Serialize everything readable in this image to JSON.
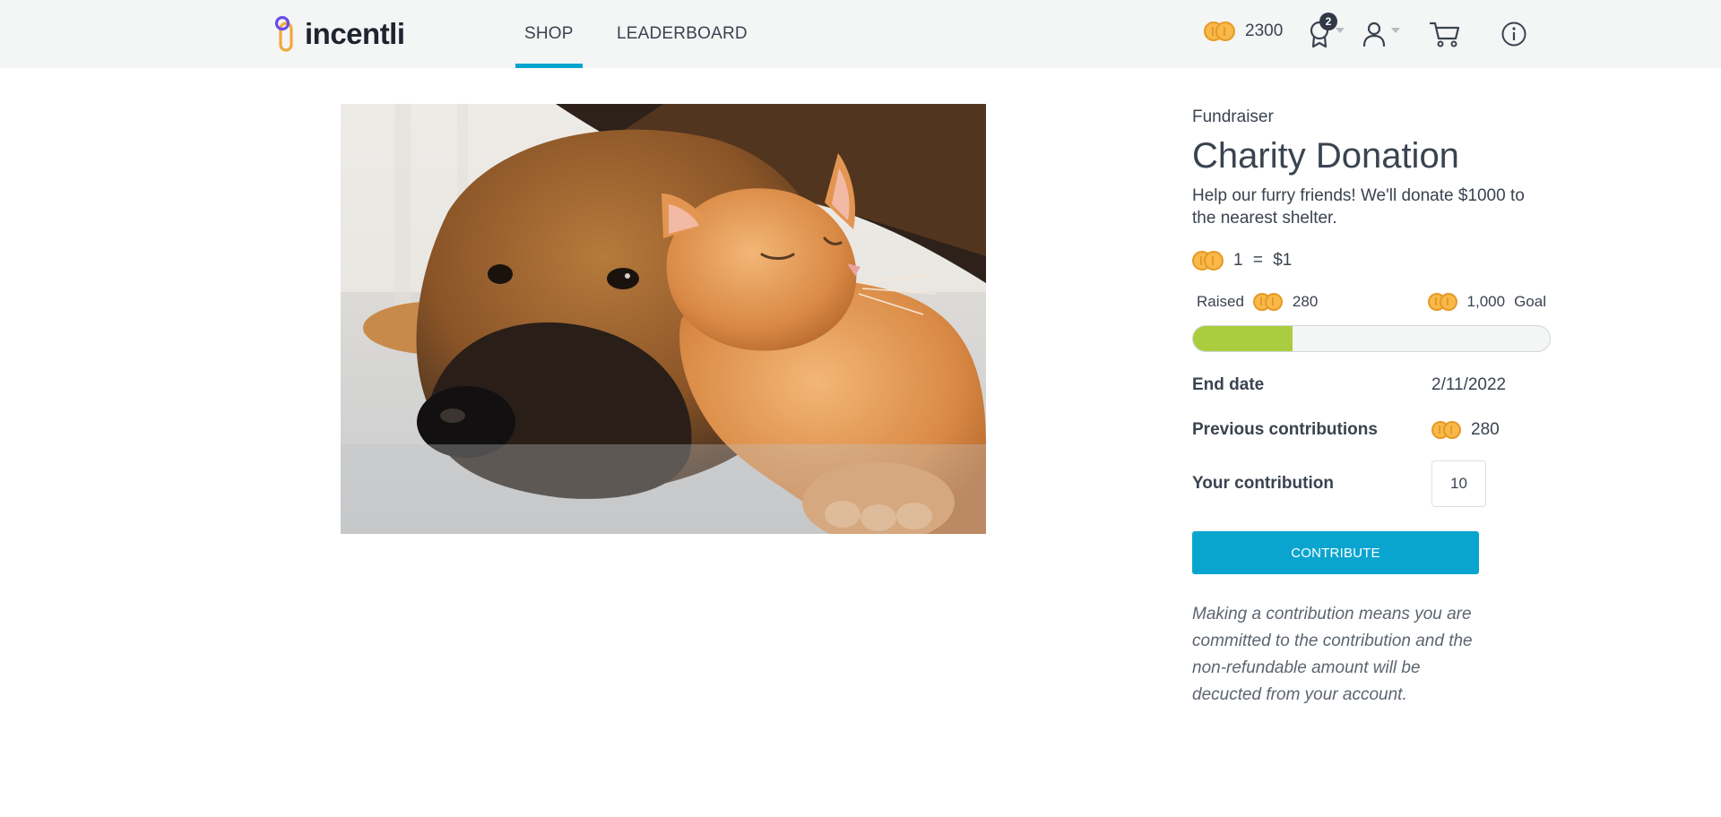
{
  "app": {
    "logo_text": "incentli"
  },
  "nav": {
    "tabs": [
      {
        "label": "SHOP",
        "active": true
      },
      {
        "label": "LEADERBOARD",
        "active": false
      }
    ]
  },
  "header": {
    "coin_balance": "2300",
    "awards_badge": "2",
    "icons": [
      "coins-icon",
      "award-icon",
      "user-icon",
      "cart-icon",
      "info-icon"
    ]
  },
  "product": {
    "category": "Fundraiser",
    "title": "Charity Donation",
    "description": "Help our furry friends! We'll donate $1000 to the nearest shelter.",
    "rate_text": "1 = $1",
    "raised_label": "Raised",
    "raised_value": "280",
    "goal_value": "1,000",
    "goal_label": "Goal",
    "progress_fraction": 0.28,
    "end_date_label": "End date",
    "end_date_value": "2/11/2022",
    "prev_contrib_label": "Previous contributions",
    "prev_contrib_value": "280",
    "your_contrib_label": "Your contribution",
    "your_contrib_value": "10",
    "button_label": "CONTRIBUTE",
    "disclaimer": "Making a contribution means you are committed to the contribution and the non-refundable amount will be decucted from your account."
  },
  "colors": {
    "accent": "#0aa5cf",
    "progress": "#a9cd3e",
    "coin": "#f8b84a",
    "header_bg": "#f4f5f5"
  }
}
